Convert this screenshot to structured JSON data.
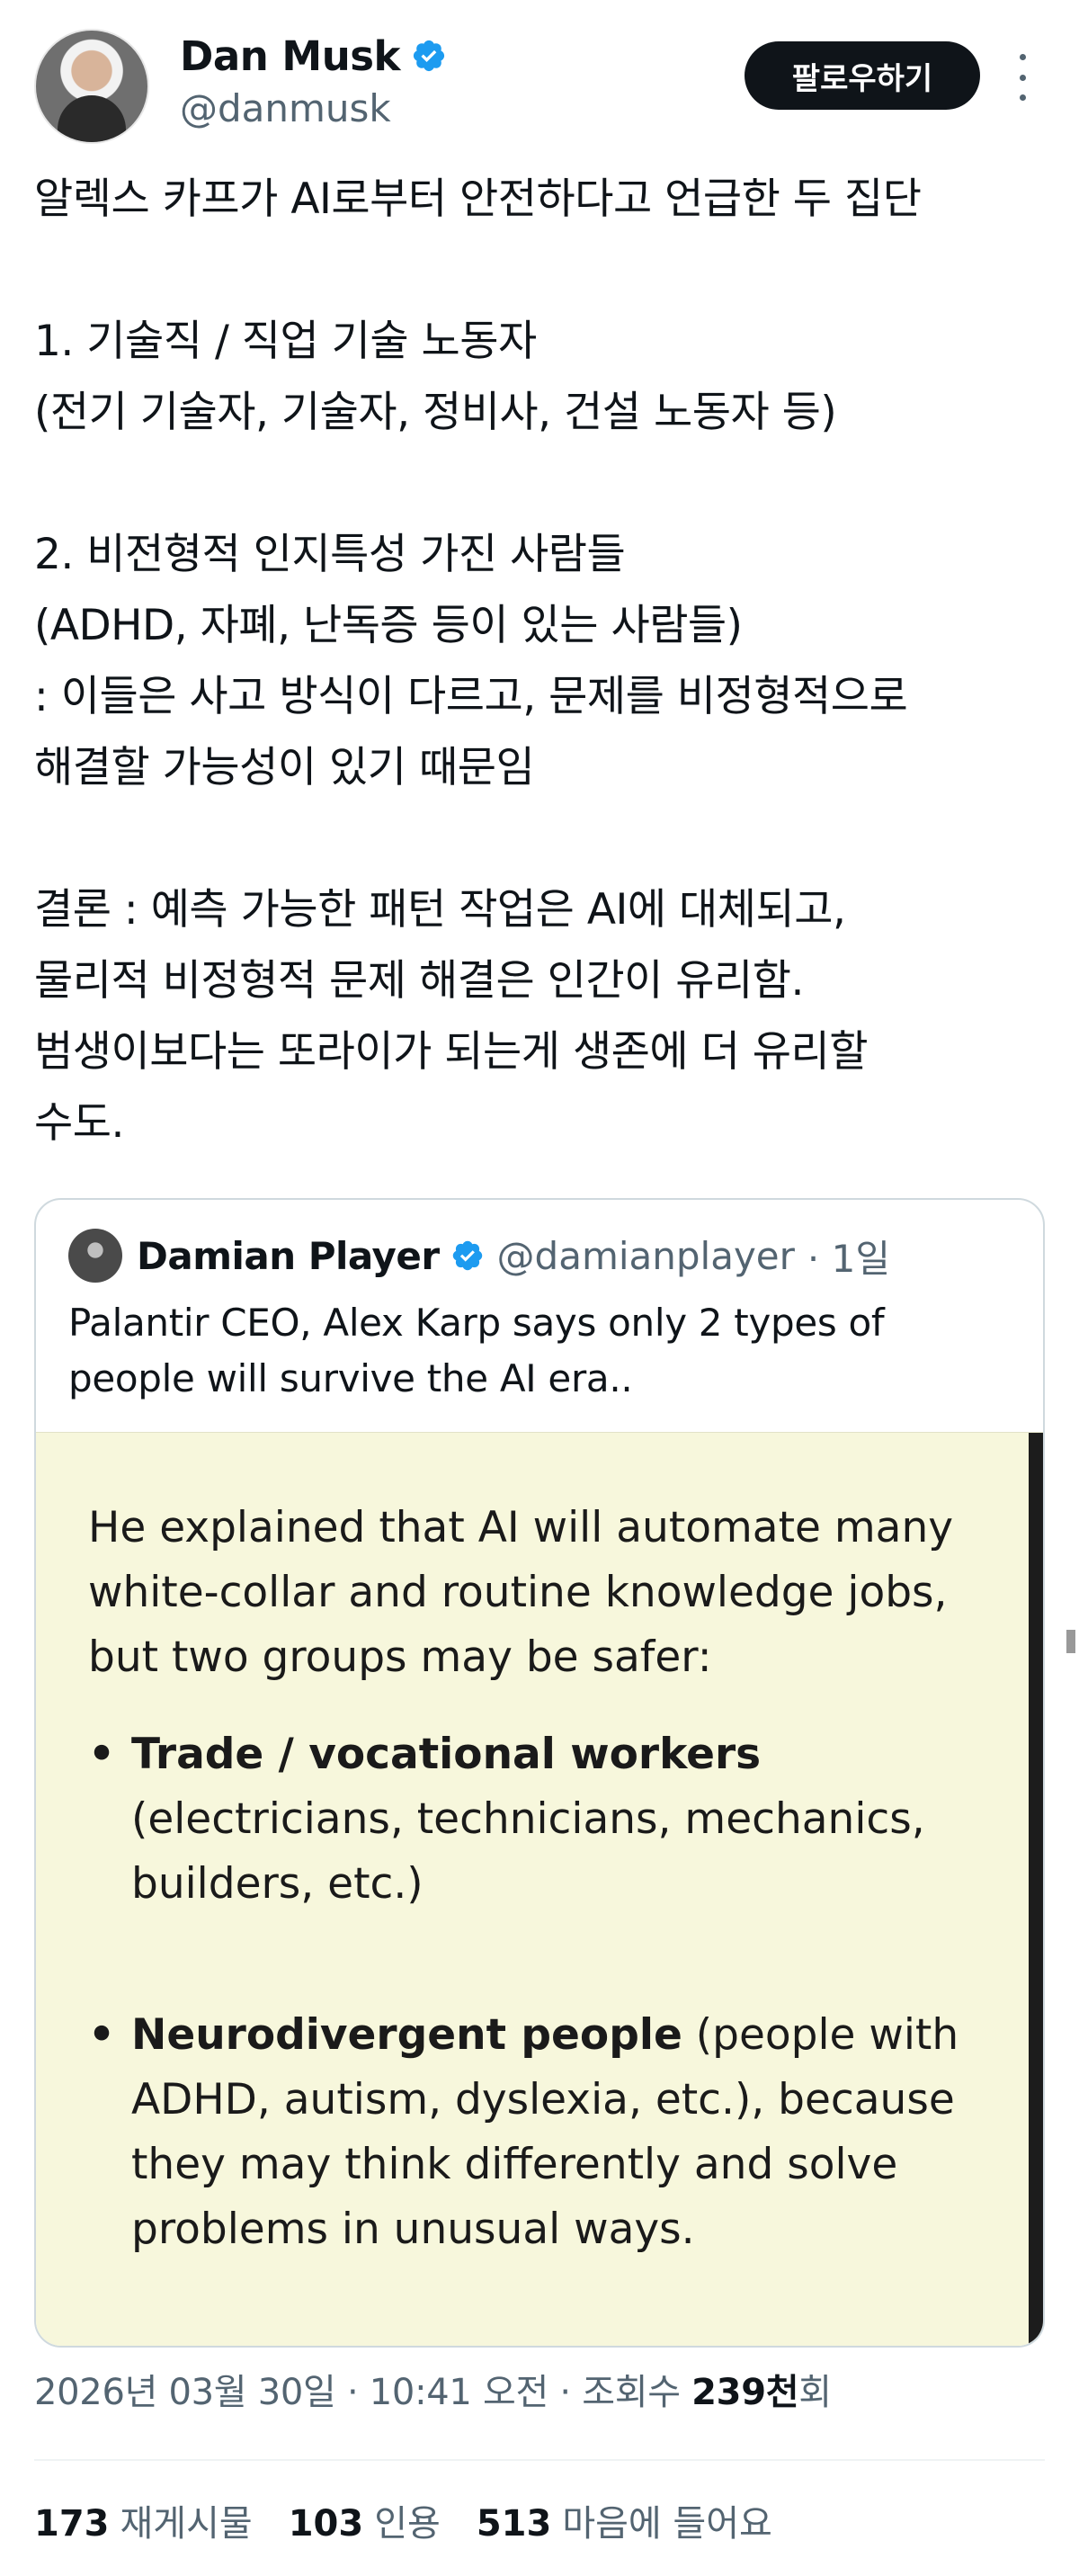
{
  "author": {
    "name": "Dan Musk",
    "handle": "@danmusk",
    "follow_label": "팔로우하기"
  },
  "tweet": {
    "text": "알렉스 카프가 AI로부터 안전하다고 언급한 두 집단\n\n1. 기술직 / 직업 기술 노동자\n(전기 기술자, 기술자, 정비사, 건설 노동자 등)\n\n2. 비전형적 인지특성 가진 사람들\n(ADHD, 자폐, 난독증 등이 있는 사람들)\n: 이들은 사고 방식이 다르고, 문제를 비정형적으로\n해결할 가능성이 있기 때문임\n\n결론 : 예측 가능한 패턴 작업은 AI에 대체되고,\n물리적 비정형적 문제 해결은 인간이 유리함.\n범생이보다는 또라이가 되는게 생존에 더 유리할\n수도."
  },
  "quote": {
    "name": "Damian Player",
    "handle": "@damianplayer",
    "time": "· 1일",
    "text": "Palantir CEO, Alex Karp says only 2 types of people will survive the AI era..",
    "image": {
      "intro": "He explained that AI will automate many white-collar and routine knowledge jobs, but two groups may be safer:",
      "bullet1_bold": "Trade / vocational workers",
      "bullet1_rest": "(electricians, technicians, mechanics, builders, etc.)",
      "bullet2_bold": "Neurodivergent people",
      "bullet2_rest": "(people with ADHD, autism, dyslexia, etc.), because they may think differently and solve problems in unusual ways."
    }
  },
  "meta": {
    "date": "2026년 03월 30일 · 10:41 오전 · 조회수",
    "views_num": "239천",
    "views_suffix": "회"
  },
  "stats": {
    "reposts_num": "173",
    "reposts_label": "재게시물",
    "quotes_num": "103",
    "quotes_label": "인용",
    "likes_num": "513",
    "likes_label": "마음에 들어요"
  },
  "colors": {
    "verified": "#1d9bf0",
    "muted": "#536471",
    "image_bg": "#f7f7dc"
  }
}
